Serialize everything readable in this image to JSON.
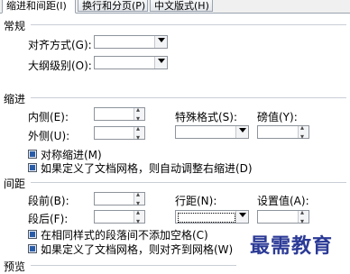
{
  "tabs": [
    {
      "label": "缩进和间距(I)"
    },
    {
      "label": "换行和分页(P)"
    },
    {
      "label": "中文版式(H)"
    }
  ],
  "general": {
    "section_title": "常规",
    "alignment_label": "对齐方式(G):",
    "alignment_value": "",
    "outline_label": "大纲级别(O):",
    "outline_value": ""
  },
  "indent": {
    "section_title": "缩进",
    "inside_label": "内侧(E):",
    "inside_value": "",
    "outside_label": "外侧(U):",
    "outside_value": "",
    "special_label": "特殊格式(S):",
    "special_value": "",
    "by_label": "磅值(Y):",
    "by_value": "",
    "mirror_label": "对称缩进(M)",
    "grid_auto_label": "如果定义了文档网格，则自动调整右缩进(D)",
    "mirror_checked": true,
    "grid_auto_checked": true
  },
  "spacing": {
    "section_title": "间距",
    "before_label": "段前(B):",
    "before_value": "",
    "after_label": "段后(F):",
    "after_value": "",
    "line_label": "行距(N):",
    "line_value": "",
    "at_label": "设置值(A):",
    "at_value": "",
    "no_space_label": "在相同样式的段落间不添加空格(C)",
    "snap_grid_label": "如果定义了文档网格，则对齐到网格(W)",
    "no_space_checked": true,
    "snap_grid_checked": true
  },
  "preview": {
    "section_title": "预览"
  },
  "watermark": {
    "text": "最需教育"
  }
}
